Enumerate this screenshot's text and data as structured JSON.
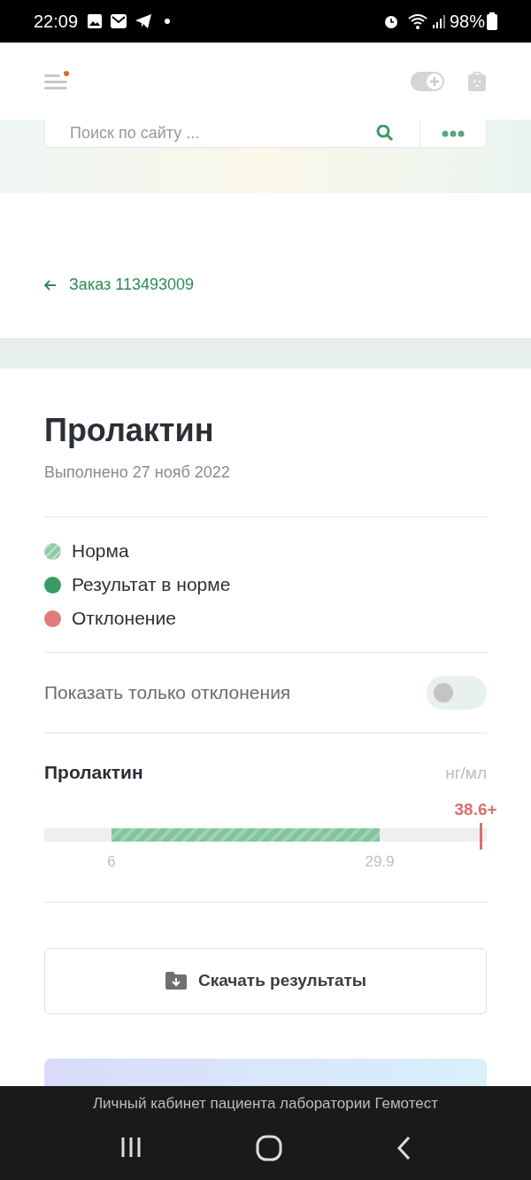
{
  "status_bar": {
    "time": "22:09",
    "battery": "98%"
  },
  "header": {
    "menu_badge": true
  },
  "search": {
    "placeholder": "Поиск по сайту ..."
  },
  "back_link": "Заказ 113493009",
  "test": {
    "title": "Пролактин",
    "date": "Выполнено 27 нояб 2022"
  },
  "legend": [
    {
      "label": "Норма",
      "color": "#8fcaa6",
      "kind": "striped"
    },
    {
      "label": "Результат в норме",
      "color": "#3a9a66",
      "kind": "solid"
    },
    {
      "label": "Отклонение",
      "color": "#e27b7b",
      "kind": "solid"
    }
  ],
  "filter": {
    "label": "Показать только отклонения",
    "on": false
  },
  "result": {
    "name": "Пролактин",
    "unit": "нг/мл",
    "value": "38.6+",
    "level": 0.983,
    "low": "6",
    "high": "29.9"
  },
  "download_button": "Скачать результаты",
  "app_caption": "Личный кабинет пациента лаборатории Гемотест"
}
